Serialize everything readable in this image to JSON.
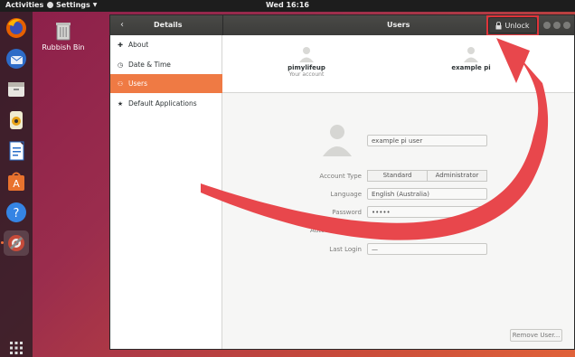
{
  "topbar": {
    "activities": "Activities",
    "app_menu": "Settings",
    "clock": "Wed 16:16"
  },
  "desktop": {
    "trash_label": "Rubbish Bin"
  },
  "dock": {
    "items": [
      "firefox-icon",
      "thunderbird-icon",
      "files-icon",
      "rhythmbox-icon",
      "libreoffice-writer-icon",
      "software-icon",
      "help-icon",
      "settings-icon",
      "app-grid-icon"
    ]
  },
  "window": {
    "left_title": "Details",
    "right_title": "Users",
    "unlock_label": "Unlock"
  },
  "sidebar": {
    "items": [
      {
        "label": "About",
        "icon": "star-icon"
      },
      {
        "label": "Date & Time",
        "icon": "clock-icon"
      },
      {
        "label": "Users",
        "icon": "users-icon",
        "selected": true
      },
      {
        "label": "Default Applications",
        "icon": "star-icon"
      }
    ]
  },
  "accounts": [
    {
      "name": "pimylifeup",
      "subtitle": "Your account"
    },
    {
      "name": "example pi",
      "subtitle": ""
    }
  ],
  "details": {
    "full_name": "example pi user",
    "account_type_label": "Account Type",
    "account_type_options": [
      "Standard",
      "Administrator"
    ],
    "language_label": "Language",
    "language_value": "English (Australia)",
    "password_label": "Password",
    "password_value": "•••••",
    "autologin_label": "Automatic Login",
    "autologin_value": "OFF",
    "last_login_label": "Last Login",
    "last_login_value": "—"
  },
  "remove_button": "Remove User...",
  "colors": {
    "accent": "#ef7a44",
    "highlight": "#e0343a",
    "arrow": "#e8474c"
  }
}
